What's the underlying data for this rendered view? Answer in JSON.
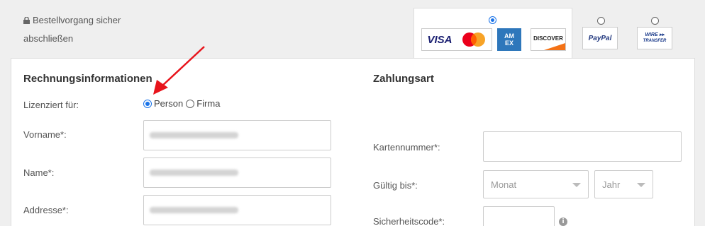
{
  "header": {
    "secure_line1": "Bestellvorgang sicher",
    "secure_line2": "abschließen"
  },
  "payment_methods": {
    "cards_selected": true,
    "visa": "VISA",
    "amex": "AM EX",
    "discover": "DISCOVER",
    "paypal": "PayPal",
    "wire": "WIRE ▸▸",
    "wire2": "TRANSFER"
  },
  "billing": {
    "title": "Rechnungsinformationen",
    "licensed_for_label": "Lizenziert für:",
    "option_person": "Person",
    "option_company": "Firma",
    "firstname_label": "Vorname*:",
    "lastname_label": "Name*:",
    "address_label": "Addresse*:"
  },
  "payment": {
    "title": "Zahlungsart",
    "card_number_label": "Kartennummer*:",
    "valid_until_label": "Gültig bis*:",
    "month_placeholder": "Monat",
    "year_placeholder": "Jahr",
    "security_code_label": "Sicherheitscode*:"
  },
  "colors": {
    "accent": "#1a73e8",
    "arrow": "#e8141c"
  }
}
